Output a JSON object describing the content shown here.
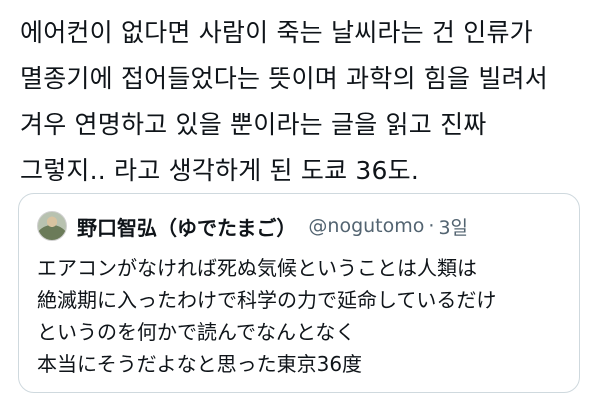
{
  "tweet": {
    "text_lines": [
      "에어컨이 없다면 사람이 죽는 날씨라는 건 인류가",
      "멸종기에 접어들었다는 뜻이며 과학의 힘을 빌려서",
      "겨우 연명하고 있을 뿐이라는 글을 읽고 진짜",
      "그렇지.. 라고 생각하게 된 도쿄 36도."
    ]
  },
  "quoted_tweet": {
    "avatar_icon": "user-avatar",
    "display_name": "野口智弘（ゆでたまご）",
    "handle": "@nogutomo",
    "separator": "·",
    "time": "3일",
    "text_lines": [
      "エアコンがなければ死ぬ気候ということは人類は",
      "絶滅期に入ったわけで科学の力で延命しているだけ",
      "というのを何かで読んでなんとなく",
      "本当にそうだよなと思った東京36度"
    ]
  },
  "colors": {
    "text": "#0f1419",
    "secondary_text": "#536471",
    "border": "#cfd9de",
    "background": "#ffffff"
  }
}
